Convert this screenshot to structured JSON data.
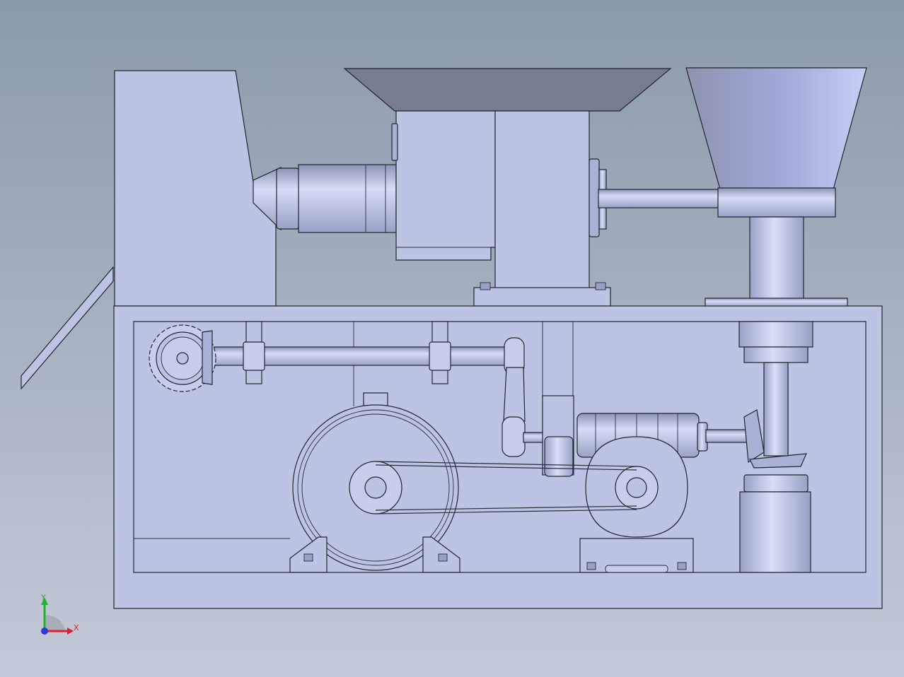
{
  "viewport": {
    "background_top": "#8c9aaa",
    "background_bottom": "#c4c9d7",
    "part_fill": "#bcc3e3",
    "part_fill_dark": "#a9b1d6",
    "part_shadow": "#777f94",
    "edge_color": "#22242e"
  },
  "triad": {
    "x_label": "X",
    "y_label": "Y",
    "x_color": "#e0202a",
    "y_color": "#1fb52a",
    "z_color": "#2a3bd8"
  }
}
